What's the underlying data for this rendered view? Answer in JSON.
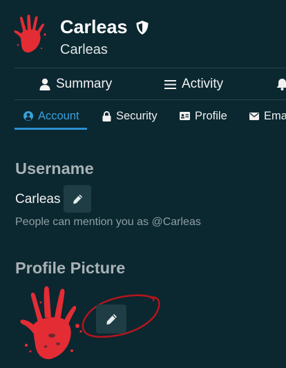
{
  "header": {
    "display_name": "Carleas",
    "username": "Carleas",
    "avatar_icon": "red-handprint-icon",
    "badge_icon": "shield-icon"
  },
  "nav": {
    "items": [
      {
        "label": "Summary",
        "icon": "user-icon"
      },
      {
        "label": "Activity",
        "icon": "list-icon"
      },
      {
        "label": "",
        "icon": "bell-icon"
      }
    ]
  },
  "tabs": [
    {
      "label": "Account",
      "icon": "user-circle-icon",
      "active": true
    },
    {
      "label": "Security",
      "icon": "lock-icon",
      "active": false
    },
    {
      "label": "Profile",
      "icon": "id-card-icon",
      "active": false
    },
    {
      "label": "Ema",
      "icon": "envelope-icon",
      "active": false
    }
  ],
  "username_section": {
    "title": "Username",
    "value": "Carleas",
    "helper": "People can mention you as @Carleas",
    "edit_icon": "pencil-icon"
  },
  "picture_section": {
    "title": "Profile Picture",
    "edit_icon": "pencil-icon",
    "avatar_icon": "red-handprint-icon"
  },
  "colors": {
    "background": "#0b2730",
    "accent": "#2d8fcf",
    "handprint": "#e32c34",
    "annotation": "#b3161c",
    "button": "#1f3d44"
  }
}
